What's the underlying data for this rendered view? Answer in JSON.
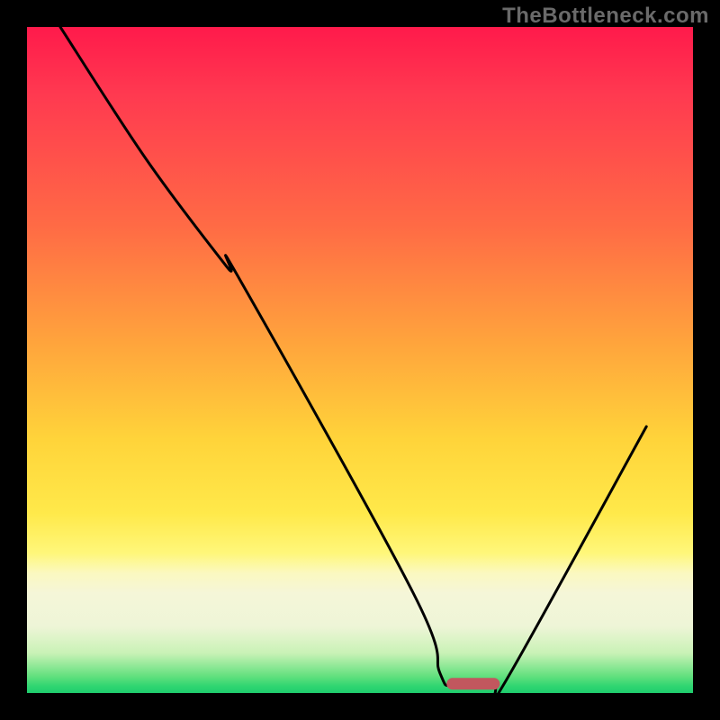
{
  "watermark": "TheBottleneck.com",
  "chart_data": {
    "type": "line",
    "title": "",
    "xlabel": "",
    "ylabel": "",
    "xlim": [
      0,
      100
    ],
    "ylim": [
      0,
      100
    ],
    "grid": false,
    "legend": false,
    "series": [
      {
        "name": "bottleneck-curve",
        "x": [
          5,
          18,
          30,
          32,
          58,
          62,
          64,
          70,
          72,
          93
        ],
        "values": [
          100,
          80,
          64,
          62,
          15,
          3,
          1,
          1,
          2,
          40
        ]
      }
    ],
    "optimum_marker": {
      "x_start": 63,
      "x_end": 71,
      "y": 0.5
    },
    "background_gradient": {
      "top": "#ff1a4b",
      "mid_upper": "#ff6b45",
      "mid": "#ffd43a",
      "mid_lower": "#f5f6d8",
      "bottom": "#1fce6e"
    }
  }
}
